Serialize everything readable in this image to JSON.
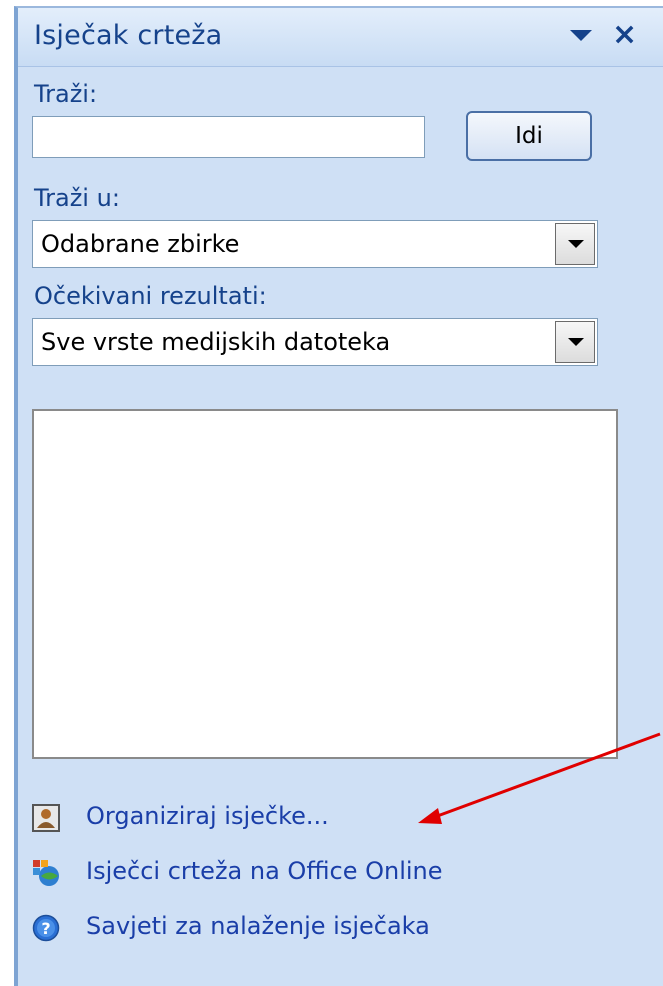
{
  "panel": {
    "title": "Isječak crteža",
    "dropdown_icon": "chevron-down-icon",
    "close_icon": "close-icon"
  },
  "search": {
    "label": "Traži:",
    "value": "",
    "placeholder": "",
    "go_button": "Idi"
  },
  "search_in": {
    "label": "Traži u:",
    "selected": "Odabrane zbirke"
  },
  "results_type": {
    "label": "Očekivani rezultati:",
    "selected": "Sve vrste medijskih datoteka"
  },
  "links": [
    {
      "label": "Organiziraj isječke...",
      "icon": "organizer-icon"
    },
    {
      "label": "Isječci crteža na Office Online",
      "icon": "office-online-icon"
    },
    {
      "label": "Savjeti za nalaženje isječaka",
      "icon": "help-icon"
    }
  ],
  "colors": {
    "accent": "#15428b",
    "link": "#1a3ea8",
    "panel_bg": "#cfe0f5",
    "annotation_arrow": "#e00000"
  }
}
